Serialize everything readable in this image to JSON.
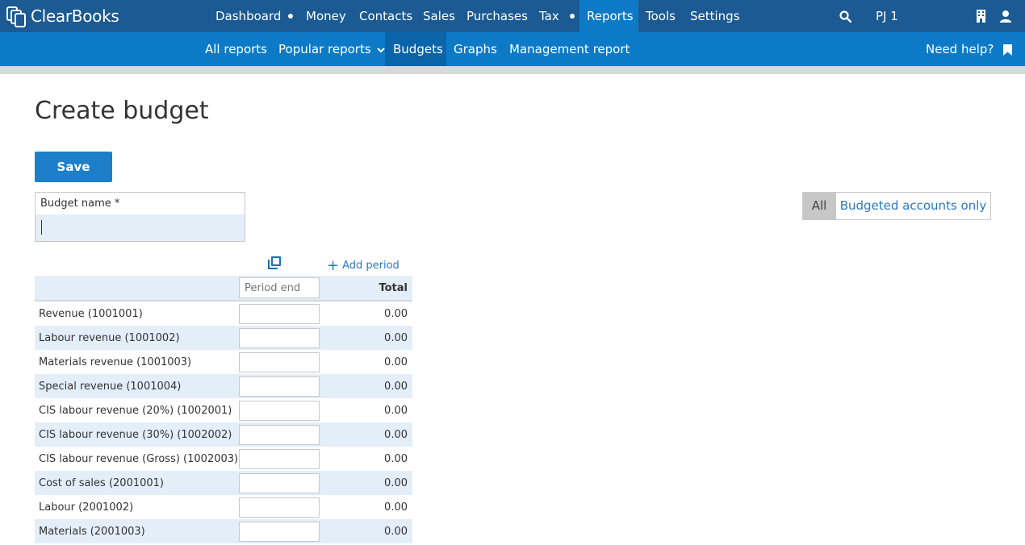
{
  "brand": {
    "logo_text": "ClearBooks"
  },
  "topnav": {
    "items": [
      {
        "label": "Dashboard"
      },
      {
        "label": "Money"
      },
      {
        "label": "Contacts"
      },
      {
        "label": "Sales"
      },
      {
        "label": "Purchases"
      },
      {
        "label": "Tax"
      },
      {
        "label": "Reports"
      },
      {
        "label": "Tools"
      },
      {
        "label": "Settings"
      }
    ],
    "active": "Reports",
    "user_label": "PJ 1"
  },
  "subnav": {
    "items": [
      {
        "label": "All reports"
      },
      {
        "label": "Popular reports"
      },
      {
        "label": "Budgets"
      },
      {
        "label": "Graphs"
      },
      {
        "label": "Management report"
      }
    ],
    "active": "Budgets",
    "help_label": "Need help?"
  },
  "page": {
    "title": "Create budget",
    "save_label": "Save",
    "budget_name_label": "Budget name *",
    "budget_name_value": "",
    "filter": {
      "all_label": "All",
      "budgeted_label": "Budgeted accounts only",
      "selected": "All"
    },
    "add_period_label": "Add period",
    "period_placeholder": "Period end",
    "total_header": "Total"
  },
  "rows": [
    {
      "label": "Revenue (1001001)",
      "total": "0.00"
    },
    {
      "label": "Labour revenue (1001002)",
      "total": "0.00"
    },
    {
      "label": "Materials revenue (1001003)",
      "total": "0.00"
    },
    {
      "label": "Special revenue (1001004)",
      "total": "0.00"
    },
    {
      "label": "CIS labour revenue (20%) (1002001)",
      "total": "0.00"
    },
    {
      "label": "CIS labour revenue (30%) (1002002)",
      "total": "0.00"
    },
    {
      "label": "CIS labour revenue (Gross) (1002003)",
      "total": "0.00"
    },
    {
      "label": "Cost of sales (2001001)",
      "total": "0.00"
    },
    {
      "label": "Labour (2001002)",
      "total": "0.00"
    },
    {
      "label": "Materials (2001003)",
      "total": "0.00"
    }
  ],
  "icons": {
    "search": "search-icon",
    "building": "building-icon",
    "user": "user-icon",
    "bookmark": "bookmark-icon",
    "copy": "copy-icon",
    "chevron": "chevron-down-icon",
    "plus": "plus-icon"
  },
  "colors": {
    "topbar": "#1b5a92",
    "subbar": "#0d7ac8",
    "active_nav": "#0d7ac8",
    "row_alt": "#e3eef8",
    "primary_button": "#1d7ec9",
    "link": "#2a78c2"
  }
}
